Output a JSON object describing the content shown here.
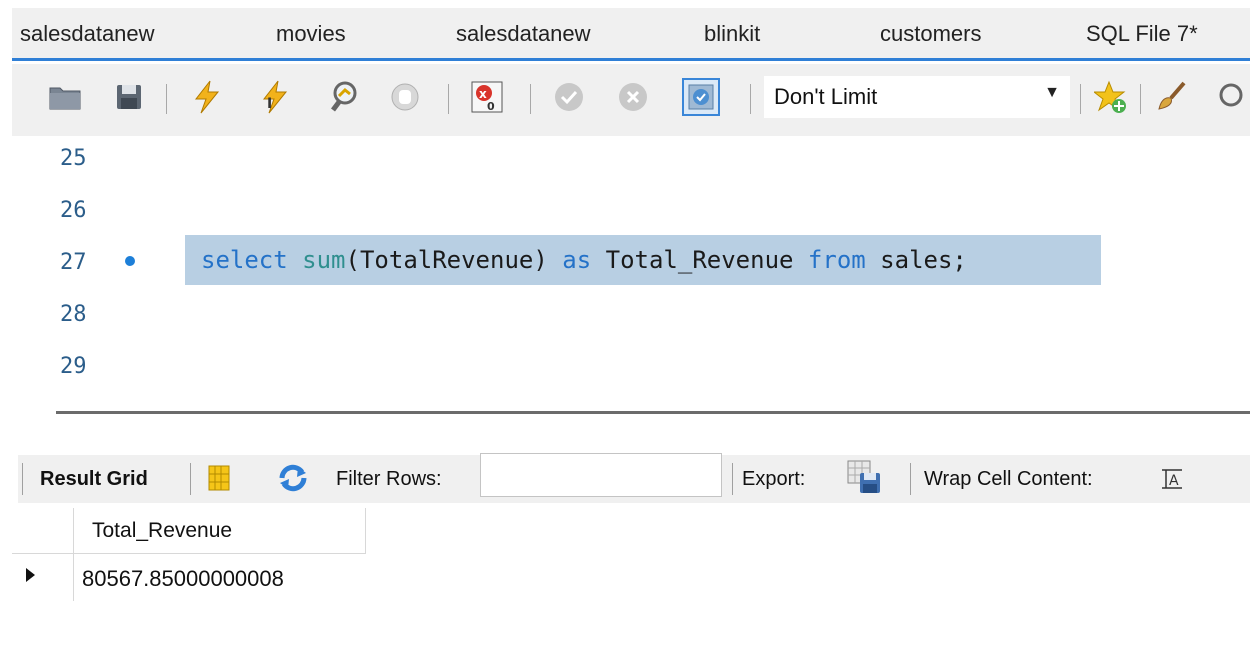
{
  "tabs": [
    "salesdatanew",
    "movies",
    "salesdatanew",
    "blinkit",
    "customers",
    "SQL File 7*"
  ],
  "toolbar": {
    "limit_label": "Don't Limit",
    "icons": [
      "open-folder-icon",
      "save-icon",
      "execute-icon",
      "execute-current-icon",
      "explain-icon",
      "stop-icon",
      "toggle-error-icon",
      "commit-icon",
      "rollback-icon",
      "autocommit-icon",
      "add-snippet-icon",
      "beautify-icon",
      "search-icon"
    ]
  },
  "editor": {
    "line_numbers": [
      "25",
      "26",
      "27",
      "28",
      "29"
    ],
    "active_line": "27",
    "code": {
      "kw_select": "select",
      "fn_sum": "sum",
      "arg": "(TotalRevenue) ",
      "kw_as": "as",
      "alias": " Total_Revenue ",
      "kw_from": "from",
      "table": " sales;"
    }
  },
  "results": {
    "result_grid_label": "Result Grid",
    "filter_rows_label": "Filter Rows:",
    "filter_value": "",
    "export_label": "Export:",
    "wrap_label": "Wrap Cell Content:",
    "columns": [
      "Total_Revenue"
    ],
    "rows": [
      [
        "80567.85000000008"
      ]
    ]
  },
  "colors": {
    "accent": "#2f7fd6",
    "selection": "#b8cfe3",
    "keyword": "#2472c8",
    "function": "#2f8f8f"
  }
}
